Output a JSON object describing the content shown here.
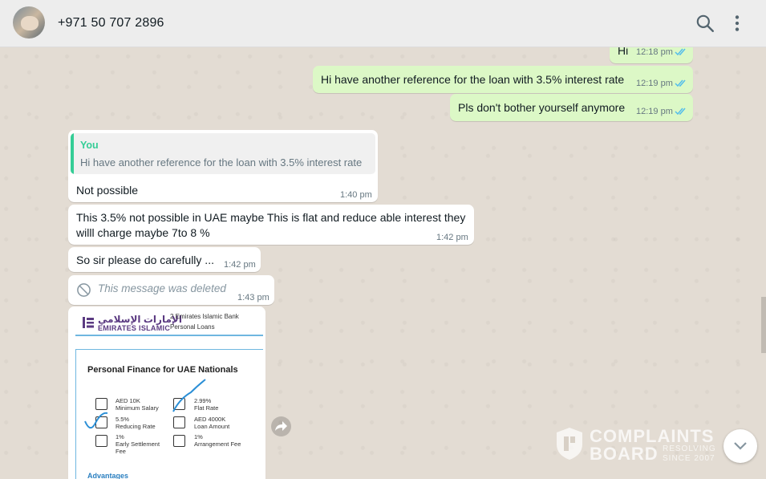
{
  "header": {
    "contact": "+971 50 707 2896",
    "icons": {
      "search": "search-icon",
      "menu": "menu-icon"
    }
  },
  "messages": {
    "out": [
      {
        "text": "Hi",
        "time": "12:18 pm"
      },
      {
        "text": "Hi have another reference for the loan with 3.5% interest rate",
        "time": "12:19 pm"
      },
      {
        "text": "Pls don't bother yourself anymore",
        "time": "12:19 pm"
      }
    ],
    "in": [
      {
        "quote_author": "You",
        "quote_text": "Hi have another reference for the loan with 3.5% interest rate",
        "text": "Not possible",
        "time": "1:40 pm"
      },
      {
        "line1": "This 3.5% not possible in UAE maybe This is  flat and reduce able interest they",
        "line2": "willl charge maybe 7to 8 %",
        "time": "1:42 pm"
      },
      {
        "text": "So sir please do carefully ...",
        "time": "1:42 pm"
      },
      {
        "text": "This message was deleted",
        "time": "1:43 pm"
      }
    ]
  },
  "document": {
    "logo_ar": "الإمارات الإسلامي",
    "logo_en": "EMIRATES ISLAMIC",
    "bank": "2 Emirates Islamic Bank",
    "section": "Personal Loans",
    "title": "Personal Finance for UAE Nationals",
    "features": [
      {
        "l1": "AED 10K",
        "l2": "Minimum Salary",
        "l3": ""
      },
      {
        "l1": "5.5%",
        "l2": "Reducing Rate",
        "l3": ""
      },
      {
        "l1": "1%",
        "l2": "Early Settlement",
        "l3": "Fee"
      },
      {
        "l1": "2.99%",
        "l2": "Flat Rate",
        "l3": ""
      },
      {
        "l1": "AED 4000K",
        "l2": "Loan Amount",
        "l3": ""
      },
      {
        "l1": "1%",
        "l2": "Arrangement Fee",
        "l3": ""
      }
    ],
    "advantages": "Advantages"
  },
  "watermark": {
    "line1": "COMPLAINTS",
    "line2": "BOARD",
    "sub1": "RESOLVING",
    "sub2": "SINCE 2007"
  },
  "colors": {
    "out_bubble": "#dcf8c6",
    "in_bubble": "#ffffff",
    "tick": "#53bdeb",
    "quote_accent": "#35cd96",
    "brand": "#5b3a82"
  }
}
